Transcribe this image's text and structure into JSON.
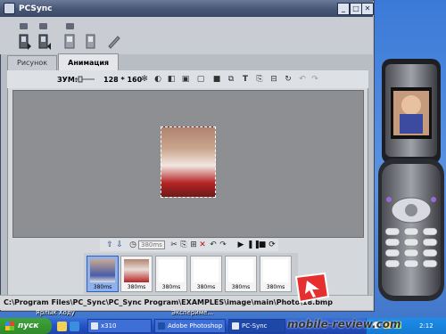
{
  "window": {
    "title": "PCSync",
    "status_path": "C:\\Program Files\\PC_Sync\\PC_Sync Program\\EXAMPLES\\image\\main\\Photo\\18.bmp"
  },
  "tabs": [
    {
      "label": "Рисунок",
      "active": false
    },
    {
      "label": "Анимация",
      "active": true
    }
  ],
  "editor": {
    "zoom_label": "ЗУМ:",
    "resolution": "128 * 160",
    "frame_delay_placeholder": "380ms"
  },
  "thumbnails": [
    {
      "duration": "380ms",
      "selected": true
    },
    {
      "duration": "380ms",
      "selected": false
    },
    {
      "duration": "380ms",
      "selected": false
    },
    {
      "duration": "380ms",
      "selected": false
    },
    {
      "duration": "380ms",
      "selected": false
    },
    {
      "duration": "380ms",
      "selected": false
    }
  ],
  "desktop": {
    "icon_label_1": "Ярлык Ходу",
    "icon_label_2": "Экспериме..."
  },
  "taskbar": {
    "start_label": "пуск",
    "tasks": [
      "x310",
      "Adobe Photoshop",
      "PC-Sync"
    ],
    "clock": "2:12"
  },
  "watermark": "mobile-review.com",
  "colors": {
    "titlebar": "#4a5878",
    "taskbar": "#2552c5",
    "start_button": "#2f8a2c",
    "selected_thumb": "#8fb2ec",
    "canvas_bg": "#8d8f92"
  }
}
